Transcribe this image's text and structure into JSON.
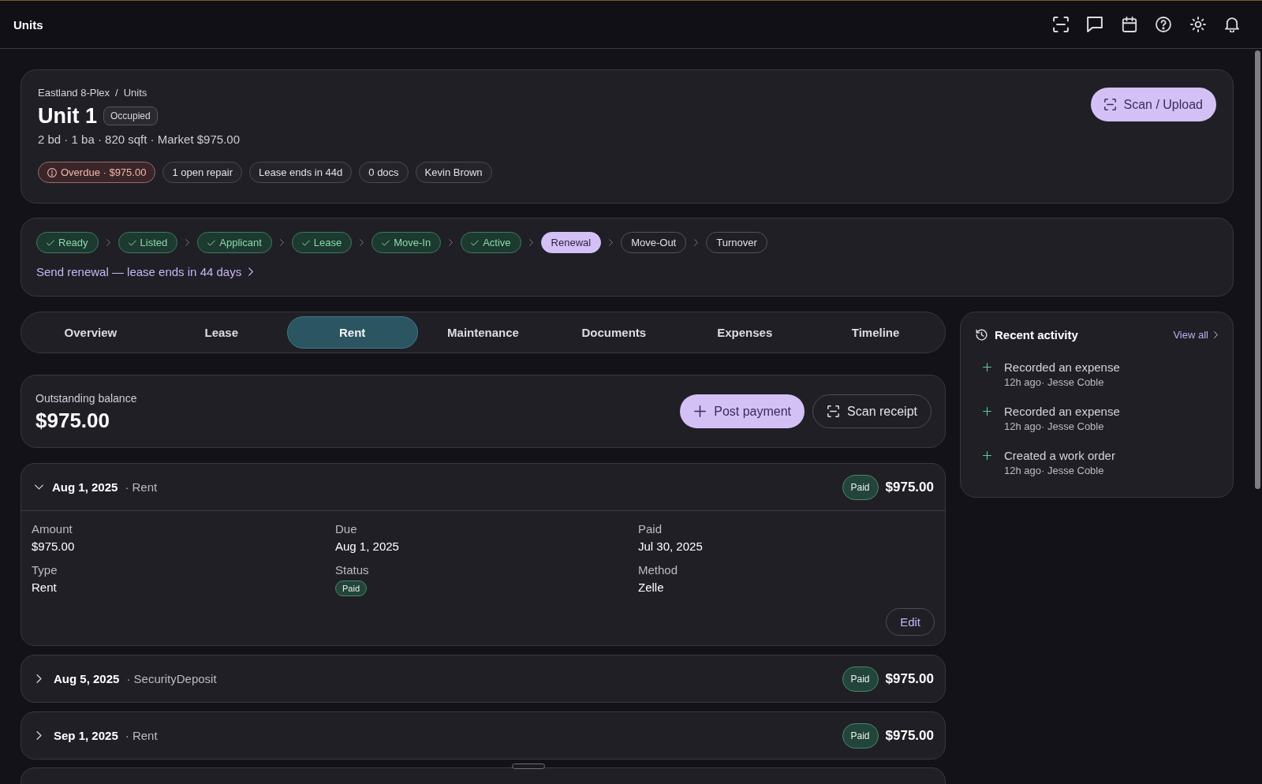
{
  "top_bar": {
    "title": "Units"
  },
  "header": {
    "breadcrumb": {
      "items": [
        "Eastland 8-Plex",
        "Units"
      ],
      "separator": "/"
    },
    "title": "Unit 1",
    "status_badge": "Occupied",
    "meta": "2 bd · 1 ba · 820 sqft · Market $975.00",
    "tags": [
      {
        "kind": "alert",
        "label": "Overdue · $975.00"
      },
      {
        "kind": "plain",
        "label": "1 open repair"
      },
      {
        "kind": "plain",
        "label": "Lease ends in 44d"
      },
      {
        "kind": "plain",
        "label": "0 docs"
      },
      {
        "kind": "plain",
        "label": "Kevin Brown"
      }
    ],
    "action_button": "Scan / Upload"
  },
  "pipeline": {
    "stages": [
      {
        "label": "Ready",
        "completed": true,
        "current": false
      },
      {
        "label": "Listed",
        "completed": true,
        "current": false
      },
      {
        "label": "Applicant",
        "completed": true,
        "current": false
      },
      {
        "label": "Lease",
        "completed": true,
        "current": false
      },
      {
        "label": "Move-In",
        "completed": true,
        "current": false
      },
      {
        "label": "Active",
        "completed": true,
        "current": false
      },
      {
        "label": "Renewal",
        "completed": false,
        "current": true
      },
      {
        "label": "Move-Out",
        "completed": false,
        "current": false
      },
      {
        "label": "Turnover",
        "completed": false,
        "current": false
      }
    ],
    "next_action": "Send renewal — lease ends in 44 days"
  },
  "tabs": [
    {
      "label": "Overview",
      "selected": false
    },
    {
      "label": "Lease",
      "selected": false
    },
    {
      "label": "Rent",
      "selected": true
    },
    {
      "label": "Maintenance",
      "selected": false
    },
    {
      "label": "Documents",
      "selected": false
    },
    {
      "label": "Expenses",
      "selected": false
    },
    {
      "label": "Timeline",
      "selected": false
    }
  ],
  "balance": {
    "label": "Outstanding balance",
    "amount": "$975.00",
    "buttons": [
      {
        "kind": "primary",
        "label": "Post payment"
      },
      {
        "kind": "secondary",
        "label": "Scan receipt"
      }
    ]
  },
  "payments": [
    {
      "date": "Aug 1, 2025",
      "category": "· Rent",
      "status": "Paid",
      "amount": "$975.00",
      "expanded": true,
      "details": [
        {
          "kind": "text",
          "label": "Amount",
          "value": "$975.00"
        },
        {
          "kind": "text",
          "label": "Due",
          "value": "Aug 1, 2025"
        },
        {
          "kind": "text",
          "label": "Paid",
          "value": "Jul 30, 2025"
        },
        {
          "kind": "text",
          "label": "Type",
          "value": "Rent"
        },
        {
          "kind": "badge",
          "label": "Status",
          "value": "Paid"
        },
        {
          "kind": "text",
          "label": "Method",
          "value": "Zelle"
        }
      ],
      "action": "Edit"
    },
    {
      "date": "Aug 5, 2025",
      "category": "· SecurityDeposit",
      "status": "Paid",
      "amount": "$975.00",
      "expanded": false
    },
    {
      "date": "Sep 1, 2025",
      "category": "· Rent",
      "status": "Paid",
      "amount": "$975.00",
      "expanded": false
    }
  ],
  "recent_activity": {
    "title": "Recent activity",
    "view_all": "View all",
    "items": [
      {
        "title": "Recorded an expense",
        "meta": "12h ago· Jesse Coble"
      },
      {
        "title": "Recorded an expense",
        "meta": "12h ago· Jesse Coble"
      },
      {
        "title": "Created a work order",
        "meta": "12h ago· Jesse Coble"
      }
    ]
  }
}
